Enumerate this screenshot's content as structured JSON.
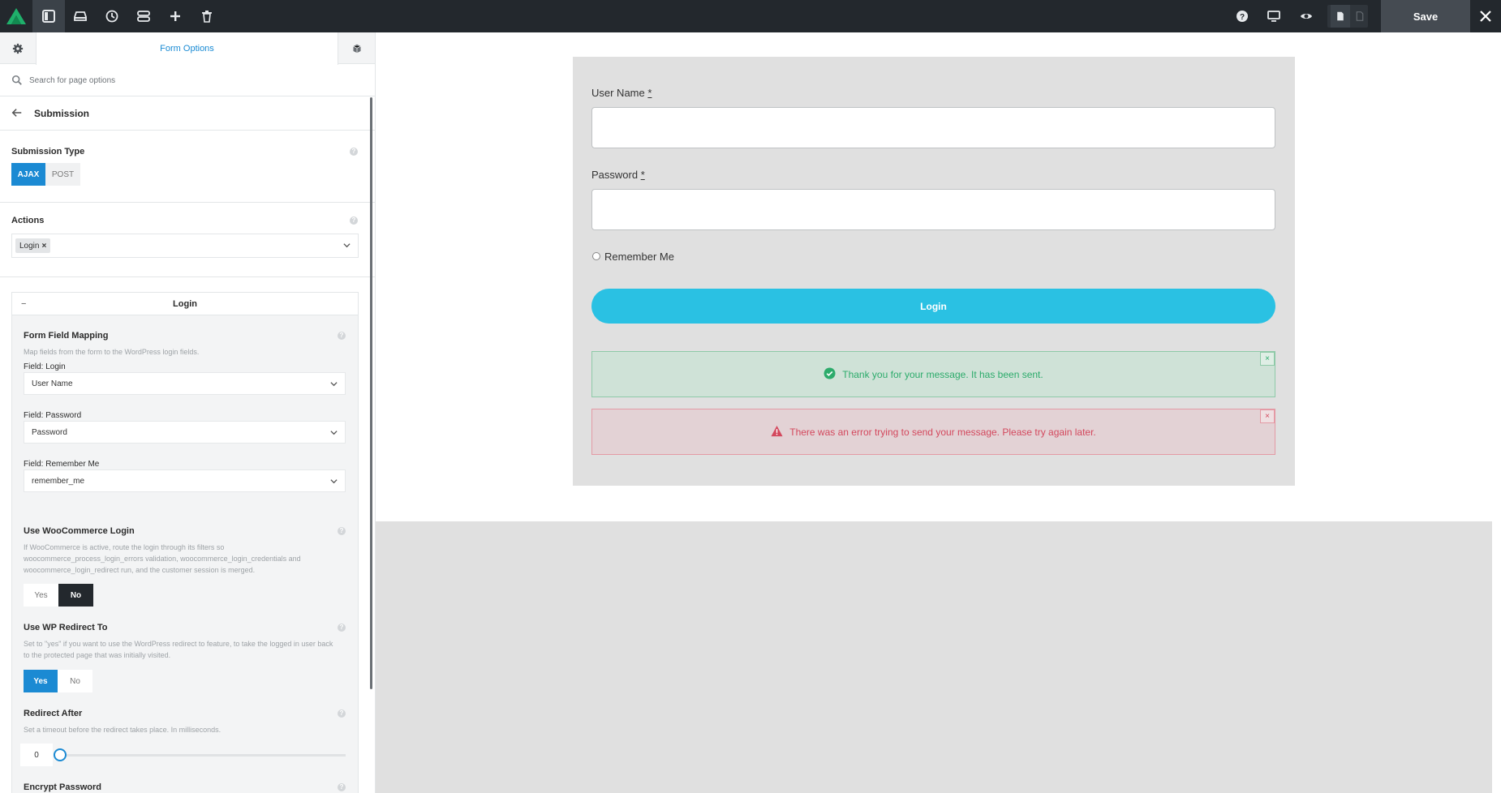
{
  "toolbar": {
    "save_label": "Save",
    "icons": [
      "builder-logo",
      "sidebar-toggle-icon",
      "library-icon",
      "history-icon",
      "navigator-icon",
      "add-icon",
      "trash-icon",
      "help-icon",
      "desktop-icon",
      "preview-icon",
      "page-icon",
      "page-outline-icon",
      "close-icon"
    ],
    "colors": {
      "bar": "#23282d",
      "logo": "#1fb06b"
    }
  },
  "sidebar": {
    "tab_title": "Form Options",
    "search_placeholder": "Search for page options",
    "section_title": "Submission",
    "submission_type": {
      "label": "Submission Type",
      "options": [
        "AJAX",
        "POST"
      ],
      "selected": "AJAX"
    },
    "actions": {
      "label": "Actions",
      "tags": [
        "Login"
      ],
      "tag_remove": "×"
    },
    "login_box": {
      "collapse": "−",
      "title": "Login",
      "mapping": {
        "label": "Form Field Mapping",
        "desc": "Map fields from the form to the WordPress login fields.",
        "fields": [
          {
            "label": "Field: Login",
            "value": "User Name"
          },
          {
            "label": "Field: Password",
            "value": "Password"
          },
          {
            "label": "Field: Remember Me",
            "value": "remember_me"
          }
        ]
      },
      "woocommerce": {
        "label": "Use WooCommerce Login",
        "desc_1": "If WooCommerce is active, route the login through its filters so",
        "desc_2": "woocommerce_process_login_errors validation, woocommerce_login_credentials and",
        "desc_3": "woocommerce_login_redirect run, and the customer session is merged.",
        "yes": "Yes",
        "no": "No",
        "selected": "No"
      },
      "wp_redirect": {
        "label": "Use WP Redirect To",
        "desc_1": "Set to \"yes\" if you want to use the WordPress redirect to feature, to take the logged in user back",
        "desc_2": "to the protected page that was initially visited.",
        "yes": "Yes",
        "no": "No",
        "selected": "Yes"
      },
      "redirect_after": {
        "label": "Redirect After",
        "desc": "Set a timeout before the redirect takes place. In milliseconds.",
        "value": "0"
      },
      "encrypt": {
        "label": "Encrypt Password"
      }
    }
  },
  "form": {
    "username_label": "User Name",
    "password_label": "Password",
    "required_mark": "*",
    "remember_label": "Remember Me",
    "button_label": "Login",
    "success_msg": "Thank you for your message. It has been sent.",
    "error_msg": "There was an error trying to send your message. Please try again later.",
    "dismiss": "×",
    "colors": {
      "button": "#2ac1e3",
      "success": "#2cab6b",
      "error": "#d3485d"
    }
  }
}
